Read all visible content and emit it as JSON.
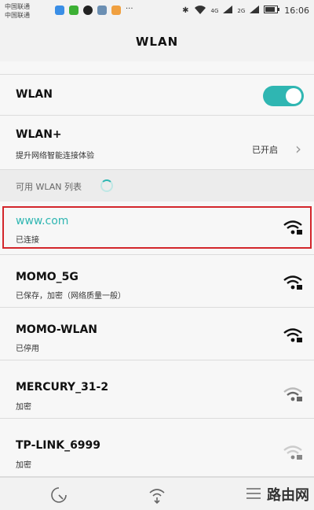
{
  "statusbar": {
    "carriers": [
      "中国联通",
      "中国联通"
    ],
    "time": "16:06",
    "network_4g": "4G",
    "network_2g": "2G"
  },
  "title": "WLAN",
  "wlan_row": {
    "label": "WLAN",
    "enabled": true
  },
  "wlan_plus": {
    "title": "WLAN+",
    "subtitle": "提升网络智能连接体验",
    "status": "已开启"
  },
  "section": {
    "label": "可用 WLAN 列表"
  },
  "networks": [
    {
      "ssid": "www.com",
      "status": "已连接",
      "signal": "strong",
      "locked": true
    },
    {
      "ssid": "MOMO_5G",
      "status": "已保存，加密（网络质量一般）",
      "signal": "strong",
      "locked": true
    },
    {
      "ssid": "MOMO-WLAN",
      "status": "已停用",
      "signal": "strong",
      "locked": true
    },
    {
      "ssid": "MERCURY_31-2",
      "status": "加密",
      "signal": "medium",
      "locked": true
    },
    {
      "ssid": "TP-LINK_6999",
      "status": "加密",
      "signal": "weak",
      "locked": true
    }
  ],
  "bottom_nav": {
    "icons": [
      "scan-icon",
      "wifi-direct-icon",
      "menu-icon"
    ],
    "watermark": "路由网"
  },
  "colors": {
    "accent": "#2fb6b2",
    "highlight": "#d3262b"
  }
}
